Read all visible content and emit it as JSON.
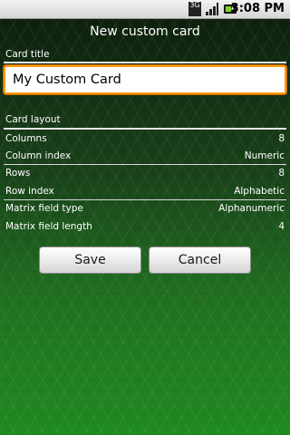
{
  "status_bar": {
    "network_label": "3G",
    "time": "3:08 PM",
    "icons": [
      "3g-icon",
      "signal-icon",
      "battery-icon"
    ]
  },
  "screen": {
    "title": "New custom card"
  },
  "card_title": {
    "label": "Card title",
    "value": "My Custom Card"
  },
  "card_layout": {
    "label": "Card layout",
    "rows": [
      {
        "key": "Columns",
        "value": "8"
      },
      {
        "key": "Column index",
        "value": "Numeric"
      },
      {
        "key": "Rows",
        "value": "8"
      },
      {
        "key": "Row index",
        "value": "Alphabetic"
      },
      {
        "key": "Matrix field type",
        "value": "Alphanumeric"
      },
      {
        "key": "Matrix field length",
        "value": "4"
      }
    ]
  },
  "buttons": {
    "save": "Save",
    "cancel": "Cancel"
  },
  "colors": {
    "focus_border": "#ff9a00",
    "background_dark": "#1b3f1b",
    "background_light": "#1f8a1f"
  }
}
